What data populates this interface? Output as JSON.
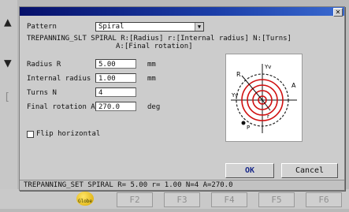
{
  "dialog": {
    "pattern_label": "Pattern",
    "pattern_value": "Spiral",
    "description_line1": "TREPANNING_SLT SPIRAL R:[Radius] r:[Internal radius] N:[Turns]",
    "description_line2": "A:[Final rotation]",
    "fields": [
      {
        "label": "Radius R",
        "value": "5.00",
        "unit": "mm"
      },
      {
        "label": "Internal radius r",
        "value": "1.00",
        "unit": "mm"
      },
      {
        "label": "Turns N",
        "value": "4",
        "unit": ""
      },
      {
        "label": "Final rotation A",
        "value": "270.0",
        "unit": "deg"
      }
    ],
    "flip_label": "Flip horizontal",
    "ok_label": "OK",
    "cancel_label": "Cancel",
    "status_text": "TREPANNING_SET SPIRAL R= 5.00 r= 1.00 N=4 A=270.0",
    "diagram": {
      "y_label": "Yv",
      "x_label": "Yv",
      "r_label": "R",
      "a_label": "A",
      "small_r_label": "r",
      "point_label": "P"
    }
  },
  "background": {
    "icon_caption": "Globe",
    "fkeys": [
      "F2",
      "F3",
      "F4",
      "F5",
      "F6"
    ]
  },
  "colors": {
    "accent_red": "#d01010",
    "title_blue": "#0a1a7a"
  }
}
